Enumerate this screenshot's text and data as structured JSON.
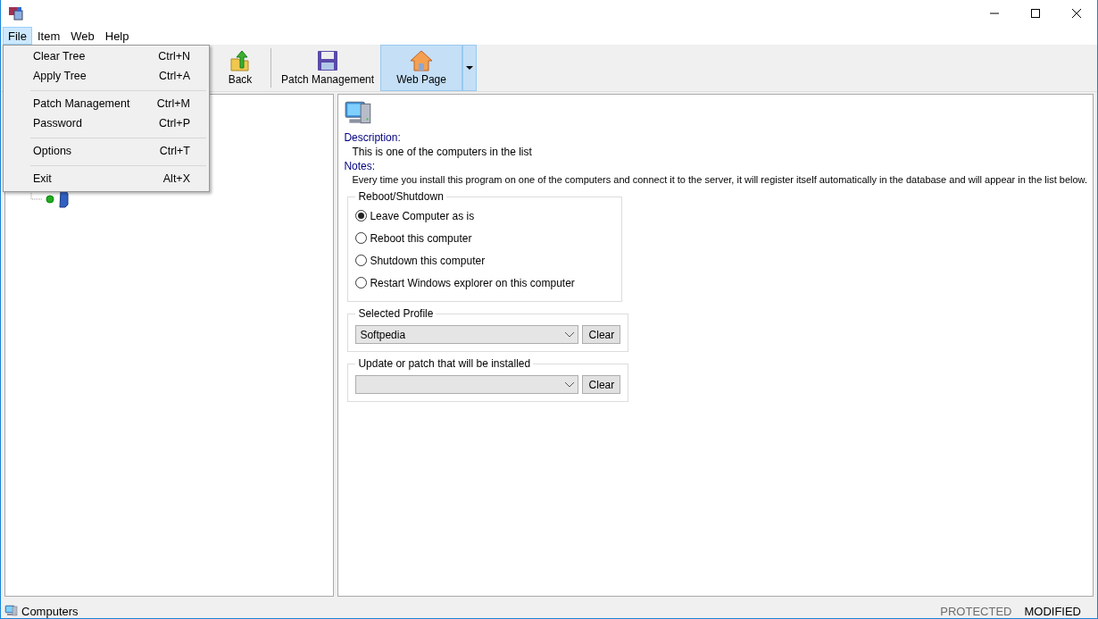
{
  "menubar": [
    {
      "label": "File",
      "selected": true
    },
    {
      "label": "Item",
      "selected": false
    },
    {
      "label": "Web",
      "selected": false
    },
    {
      "label": "Help",
      "selected": false
    }
  ],
  "file_menu": [
    {
      "kind": "item",
      "label": "Clear Tree",
      "shortcut": "Ctrl+N"
    },
    {
      "kind": "item",
      "label": "Apply Tree",
      "shortcut": "Ctrl+A"
    },
    {
      "kind": "separator"
    },
    {
      "kind": "item",
      "label": "Patch Management",
      "shortcut": "Ctrl+M"
    },
    {
      "kind": "item",
      "label": "Password",
      "shortcut": "Ctrl+P"
    },
    {
      "kind": "separator"
    },
    {
      "kind": "item",
      "label": "Options",
      "shortcut": "Ctrl+T"
    },
    {
      "kind": "separator"
    },
    {
      "kind": "item",
      "label": "Exit",
      "shortcut": "Alt+X"
    }
  ],
  "toolbar": [
    {
      "kind": "back",
      "label": "Back",
      "selected": false
    },
    {
      "kind": "save",
      "label": "Patch Management",
      "selected": false
    },
    {
      "kind": "home",
      "label": "Web Page",
      "selected": true
    }
  ],
  "details": {
    "description_label": "Description:",
    "description": "This is one of the computers in the list",
    "notes_label": "Notes:",
    "notes": "Every time you install this program on one of the computers and connect it to the server, it will register itself automatically in the database and will appear in the list below.",
    "reboot_group": {
      "title": "Reboot/Shutdown",
      "options": [
        {
          "label": "Leave Computer as is",
          "selected": true
        },
        {
          "label": "Reboot this computer",
          "selected": false
        },
        {
          "label": "Shutdown this computer",
          "selected": false
        },
        {
          "label": "Restart Windows explorer on this computer",
          "selected": false
        }
      ]
    },
    "profile_group": {
      "title": "Selected Profile",
      "value": "Softpedia",
      "button": "Clear"
    },
    "patch_group": {
      "title": "Update or patch that will be installed",
      "button": "Clear"
    }
  },
  "status_bar": {
    "label": "Computers",
    "flags": [
      {
        "label": "PROTECTED",
        "disabled": true
      },
      {
        "label": "MODIFIED",
        "disabled": false
      }
    ]
  }
}
